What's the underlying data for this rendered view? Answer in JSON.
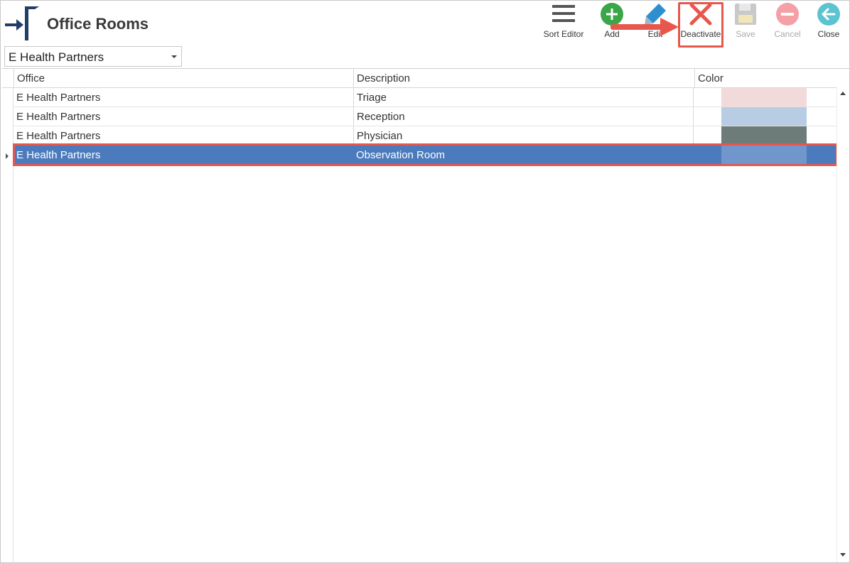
{
  "app": {
    "title": "Office Rooms"
  },
  "toolbar": {
    "sort_editor": "Sort Editor",
    "add": "Add",
    "edit": "Edit",
    "deactivate": "Deactivate",
    "save": "Save",
    "cancel": "Cancel",
    "close": "Close"
  },
  "office_select": {
    "value": "E Health Partners"
  },
  "grid": {
    "columns": [
      "Office",
      "Description",
      "Color"
    ],
    "rows": [
      {
        "office": "E Health Partners",
        "description": "Triage",
        "color": "#f2dada"
      },
      {
        "office": "E Health Partners",
        "description": "Reception",
        "color": "#b8cce4"
      },
      {
        "office": "E Health Partners",
        "description": "Physician",
        "color": "#6d7b79"
      },
      {
        "office": "E Health Partners",
        "description": "Observation Room",
        "color": "#7096cc",
        "selected": true
      }
    ]
  },
  "colors": {
    "accent_red": "#e8574c",
    "selection_blue": "#4c7bbd",
    "add_green": "#3aa648",
    "edit_blue": "#2d8fce",
    "close_teal": "#5ec3d0",
    "cancel_pink": "#f4a0a6"
  },
  "icons": {
    "logo": "brand-logo-icon",
    "sort_editor": "hamburger-menu-icon",
    "add": "plus-circle-icon",
    "edit": "pencil-icon",
    "deactivate": "x-icon",
    "save": "floppy-disk-icon",
    "cancel": "minus-circle-icon",
    "close": "back-arrow-circle-icon"
  }
}
